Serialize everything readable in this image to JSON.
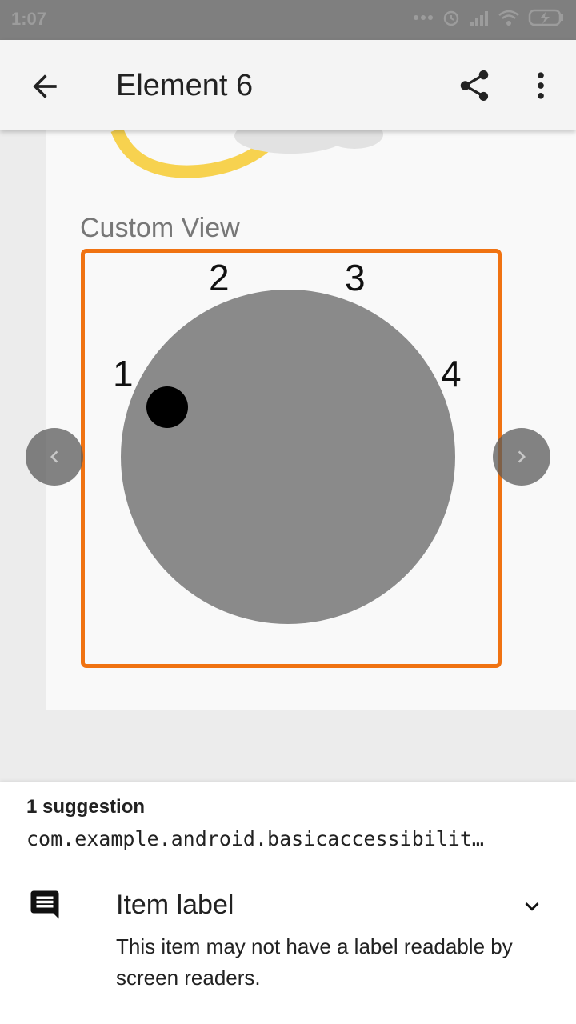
{
  "status_bar": {
    "time": "1:07"
  },
  "app_bar": {
    "title": "Element 6"
  },
  "content": {
    "custom_view_label": "Custom View",
    "dial_labels": [
      "1",
      "2",
      "3",
      "4"
    ]
  },
  "sheet": {
    "count": "1 suggestion",
    "package": "com.example.android.basicaccessibilit…",
    "item_title": "Item label",
    "item_description": "This item may not have a label readable by screen readers."
  },
  "colors": {
    "highlight": "#f07312",
    "dial": "#8a8a8a",
    "app_bar": "#f4f4f4"
  },
  "icons": [
    "back-arrow-icon",
    "share-icon",
    "more-vert-icon",
    "chevron-left-icon",
    "chevron-right-icon",
    "message-icon",
    "chevron-down-icon"
  ]
}
